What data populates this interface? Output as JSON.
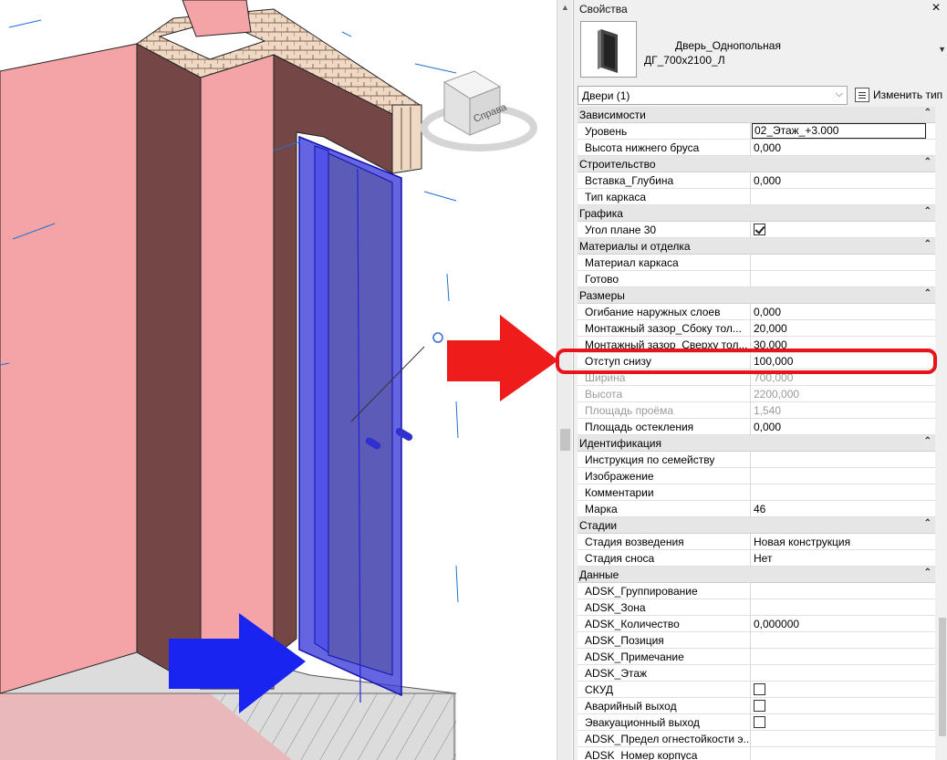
{
  "viewport": {
    "viewcube_label": "Справа"
  },
  "properties_panel": {
    "title": "Свойства",
    "close_glyph": "×",
    "type_name_line1": "Дверь_Однопольная",
    "type_name_line2": "ДГ_700х2100_Л",
    "filter_label": "Двери (1)",
    "edit_type_label": "Изменить тип",
    "groups": [
      {
        "label": "Зависимости",
        "rows": [
          {
            "key": "Уровень",
            "value": "02_Этаж_+3.000",
            "editing": true
          },
          {
            "key": "Высота нижнего бруса",
            "value": "0,000"
          }
        ]
      },
      {
        "label": "Строительство",
        "rows": [
          {
            "key": "Вставка_Глубина",
            "value": "0,000"
          },
          {
            "key": "Тип каркаса",
            "value": ""
          }
        ]
      },
      {
        "label": "Графика",
        "rows": [
          {
            "key": "Угол плане 30",
            "value": "",
            "checkbox": true,
            "checked": true
          }
        ]
      },
      {
        "label": "Материалы и отделка",
        "rows": [
          {
            "key": "Материал каркаса",
            "value": ""
          },
          {
            "key": "Готово",
            "value": ""
          }
        ]
      },
      {
        "label": "Размеры",
        "rows": [
          {
            "key": "Огибание наружных слоев",
            "value": "0,000"
          },
          {
            "key": "Монтажный зазор_Сбоку тол...",
            "value": "20,000"
          },
          {
            "key": "Монтажный зазор_Сверху тол...",
            "value": "30,000"
          },
          {
            "key": "Отступ снизу",
            "value": "100,000",
            "highlighted": true
          },
          {
            "key": "Ширина",
            "value": "700,000",
            "disabled": true
          },
          {
            "key": "Высота",
            "value": "2200,000",
            "disabled": true
          },
          {
            "key": "Площадь проёма",
            "value": "1,540",
            "disabled": true
          },
          {
            "key": "Площадь остекления",
            "value": "0,000"
          }
        ]
      },
      {
        "label": "Идентификация",
        "rows": [
          {
            "key": "Инструкция по семейству",
            "value": ""
          },
          {
            "key": "Изображение",
            "value": ""
          },
          {
            "key": "Комментарии",
            "value": ""
          },
          {
            "key": "Марка",
            "value": "46"
          }
        ]
      },
      {
        "label": "Стадии",
        "rows": [
          {
            "key": "Стадия возведения",
            "value": "Новая конструкция"
          },
          {
            "key": "Стадия сноса",
            "value": "Нет"
          }
        ]
      },
      {
        "label": "Данные",
        "rows": [
          {
            "key": "ADSK_Группирование",
            "value": ""
          },
          {
            "key": "ADSK_Зона",
            "value": ""
          },
          {
            "key": "ADSK_Количество",
            "value": "0,000000"
          },
          {
            "key": "ADSK_Позиция",
            "value": ""
          },
          {
            "key": "ADSK_Примечание",
            "value": ""
          },
          {
            "key": "ADSK_Этаж",
            "value": ""
          },
          {
            "key": "СКУД",
            "value": "",
            "checkbox": true,
            "checked": false
          },
          {
            "key": "Аварийный выход",
            "value": "",
            "checkbox": true,
            "checked": false
          },
          {
            "key": "Эвакуационный выход",
            "value": "",
            "checkbox": true,
            "checked": false
          },
          {
            "key": "ADSK_Предел огнестойкости э...",
            "value": ""
          },
          {
            "key": "ADSK_Номер корпуса",
            "value": ""
          }
        ]
      }
    ]
  },
  "colors": {
    "wall_face": "#f4a3a6",
    "wall_side": "#744746",
    "door_selected": "#3a3ad8",
    "arrow_red": "#ef1c1c",
    "arrow_blue": "#1a24f0",
    "highlight_box": "#e8141b"
  }
}
